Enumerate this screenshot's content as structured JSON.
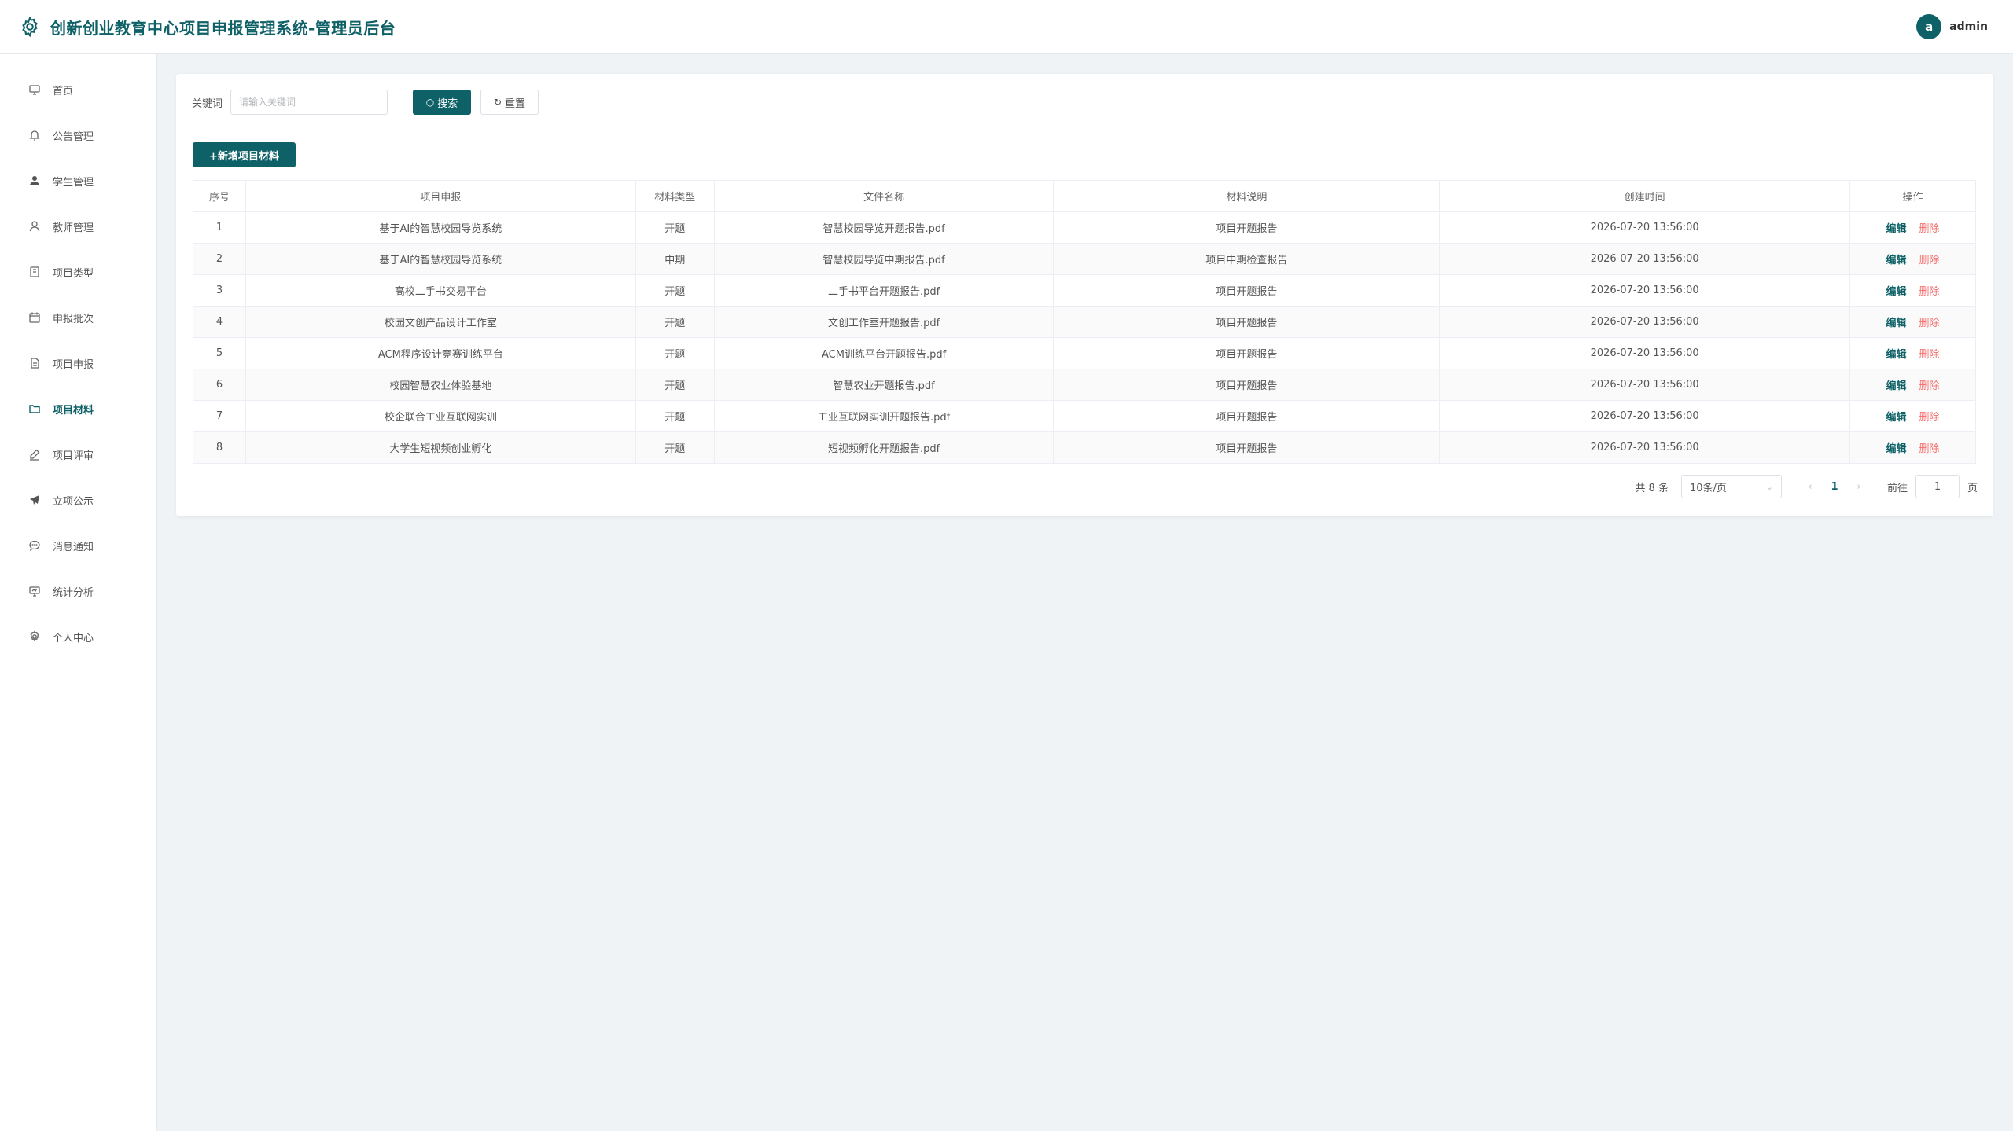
{
  "app": {
    "title": "创新创业教育中心项目申报管理系统-管理员后台"
  },
  "user": {
    "avatar_letter": "a",
    "name": "admin"
  },
  "theme": {
    "accent": "#0f6168",
    "danger": "#f56c6c"
  },
  "sidebar": {
    "items": [
      {
        "label": "首页",
        "icon": "home-icon"
      },
      {
        "label": "公告管理",
        "icon": "bell-icon"
      },
      {
        "label": "学生管理",
        "icon": "user-filled-icon"
      },
      {
        "label": "教师管理",
        "icon": "user-icon"
      },
      {
        "label": "项目类型",
        "icon": "notebook-icon"
      },
      {
        "label": "申报批次",
        "icon": "calendar-icon"
      },
      {
        "label": "项目申报",
        "icon": "document-icon"
      },
      {
        "label": "项目材料",
        "icon": "folder-icon",
        "active": true
      },
      {
        "label": "项目评审",
        "icon": "edit-pen-icon"
      },
      {
        "label": "立项公示",
        "icon": "send-icon"
      },
      {
        "label": "消息通知",
        "icon": "chat-icon"
      },
      {
        "label": "统计分析",
        "icon": "monitor-icon"
      },
      {
        "label": "个人中心",
        "icon": "setting-icon"
      }
    ]
  },
  "search": {
    "label": "关键词",
    "placeholder": "请输入关键词",
    "value": "",
    "search_label": "搜索",
    "reset_label": "重置"
  },
  "toolbar": {
    "add_label": "+新增项目材料"
  },
  "table": {
    "headers": [
      "序号",
      "项目申报",
      "材料类型",
      "文件名称",
      "材料说明",
      "创建时间",
      "操作"
    ],
    "rows": [
      [
        "1",
        "基于AI的智慧校园导览系统",
        "开题",
        "智慧校园导览开题报告.pdf",
        "项目开题报告",
        "2026-07-20 13:56:00"
      ],
      [
        "2",
        "基于AI的智慧校园导览系统",
        "中期",
        "智慧校园导览中期报告.pdf",
        "项目中期检查报告",
        "2026-07-20 13:56:00"
      ],
      [
        "3",
        "高校二手书交易平台",
        "开题",
        "二手书平台开题报告.pdf",
        "项目开题报告",
        "2026-07-20 13:56:00"
      ],
      [
        "4",
        "校园文创产品设计工作室",
        "开题",
        "文创工作室开题报告.pdf",
        "项目开题报告",
        "2026-07-20 13:56:00"
      ],
      [
        "5",
        "ACM程序设计竞赛训练平台",
        "开题",
        "ACM训练平台开题报告.pdf",
        "项目开题报告",
        "2026-07-20 13:56:00"
      ],
      [
        "6",
        "校园智慧农业体验基地",
        "开题",
        "智慧农业开题报告.pdf",
        "项目开题报告",
        "2026-07-20 13:56:00"
      ],
      [
        "7",
        "校企联合工业互联网实训",
        "开题",
        "工业互联网实训开题报告.pdf",
        "项目开题报告",
        "2026-07-20 13:56:00"
      ],
      [
        "8",
        "大学生短视频创业孵化",
        "开题",
        "短视频孵化开题报告.pdf",
        "项目开题报告",
        "2026-07-20 13:56:00"
      ]
    ],
    "edit_label": "编辑",
    "delete_label": "删除"
  },
  "pagination": {
    "total_text": "共 8 条",
    "page_size": "10条/页",
    "current_page": "1",
    "goto_label": "前往",
    "goto_value": "1",
    "unit": "页"
  }
}
